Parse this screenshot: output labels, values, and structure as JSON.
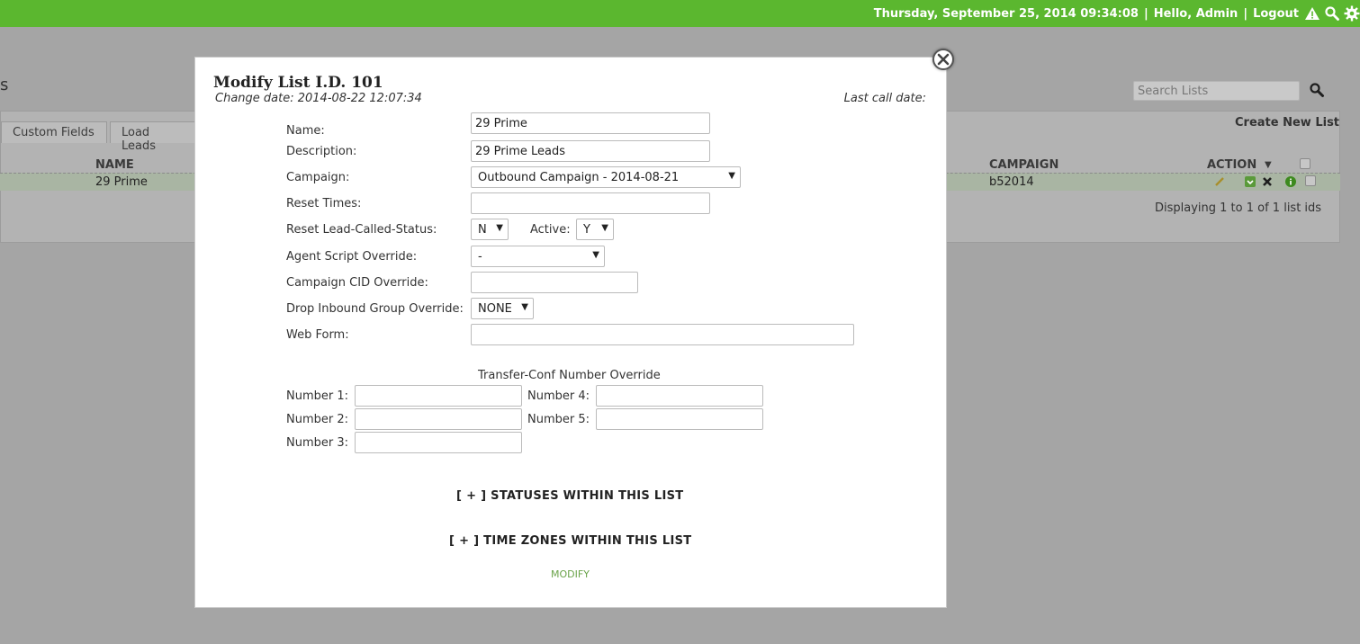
{
  "topbar": {
    "datetime": "Thursday, September 25, 2014 09:34:08",
    "greeting": "Hello, Admin",
    "logout": "Logout",
    "separator": "|"
  },
  "background": {
    "heading_fragment": "s",
    "search_placeholder": "Search Lists",
    "tabs": [
      "Custom Fields",
      "Load Leads"
    ],
    "create_new": "Create New List",
    "columns": {
      "name": "NAME",
      "campaign": "CAMPAIGN",
      "action": "ACTION"
    },
    "row": {
      "name": "29 Prime",
      "campaign": "b52014"
    },
    "displaying": "Displaying 1 to 1 of 1 list ids"
  },
  "modal": {
    "title": "Modify List I.D. 101",
    "change_date": "Change date: 2014-08-22 12:07:34",
    "last_call": "Last call date:",
    "fields": {
      "name_label": "Name:",
      "name_value": "29 Prime",
      "description_label": "Description:",
      "description_value": "29 Prime Leads",
      "campaign_label": "Campaign:",
      "campaign_value": "Outbound Campaign - 2014-08-21",
      "reset_times_label": "Reset Times:",
      "reset_times_value": "",
      "reset_status_label": "Reset Lead-Called-Status:",
      "reset_status_value": "N",
      "active_label": "Active:",
      "active_value": "Y",
      "agent_script_label": "Agent Script Override:",
      "agent_script_value": "-",
      "campaign_cid_label": "Campaign CID Override:",
      "campaign_cid_value": "",
      "drop_inbound_label": "Drop Inbound Group Override:",
      "drop_inbound_value": "NONE",
      "web_form_label": "Web Form:",
      "web_form_value": ""
    },
    "transfer": {
      "title": "Transfer-Conf Number Override",
      "number1_label": "Number 1:",
      "number2_label": "Number 2:",
      "number3_label": "Number 3:",
      "number4_label": "Number 4:",
      "number5_label": "Number 5:"
    },
    "statuses_link": "[ + ] STATUSES WITHIN THIS LIST",
    "timezones_link": "[ + ] TIME ZONES WITHIN THIS LIST",
    "modify_button": "MODIFY"
  },
  "colors": {
    "topbar": "#5bb72f",
    "accent_link": "#6aa34a"
  },
  "icons": {
    "alert": "warning-icon",
    "search": "search-icon",
    "settings": "gear-icon",
    "close": "close-icon",
    "edit": "pencil-icon",
    "download": "download-icon",
    "delete": "delete-icon",
    "info": "info-icon"
  }
}
